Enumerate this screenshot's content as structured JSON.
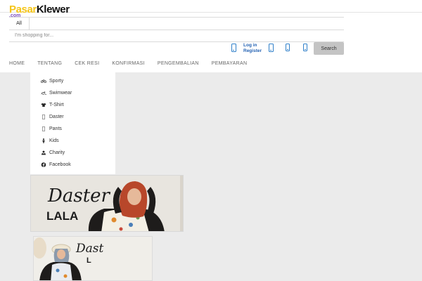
{
  "brand": {
    "part1": "Pasar",
    "part2": "Klewer",
    "suffix": ".com"
  },
  "search": {
    "category": "All",
    "placeholder": "I'm shopping for...",
    "button": "Search"
  },
  "account": {
    "login": "Log in",
    "register": "Register"
  },
  "header_icons": [
    "phone-icon",
    "tablet-icon",
    "phone-icon",
    "phone-icon"
  ],
  "nav": [
    "HOME",
    "TENTANG",
    "CEK RESI",
    "KONFIRMASI",
    "PENGEMBALIAN",
    "PEMBAYARAN"
  ],
  "categories": [
    {
      "label": "Sporty",
      "icon": "bicycle-icon"
    },
    {
      "label": "Swimwear",
      "icon": "swimmer-icon"
    },
    {
      "label": "T-Shirt",
      "icon": "tshirt-icon"
    },
    {
      "label": "Daster",
      "icon": "placeholder-icon"
    },
    {
      "label": "Pants",
      "icon": "placeholder-icon"
    },
    {
      "label": "Kids",
      "icon": "child-icon"
    },
    {
      "label": "Charity",
      "icon": "hands-icon"
    },
    {
      "label": "Facebook",
      "icon": "facebook-icon"
    }
  ],
  "banners": [
    {
      "script": "Daster",
      "bold": "LALA"
    },
    {
      "script": "Dast",
      "bold": "L"
    }
  ],
  "colors": {
    "brand_yellow": "#f5c518",
    "link_blue": "#2462b3",
    "icon_blue": "#2f7fc9",
    "hijab": "#b8472a"
  }
}
